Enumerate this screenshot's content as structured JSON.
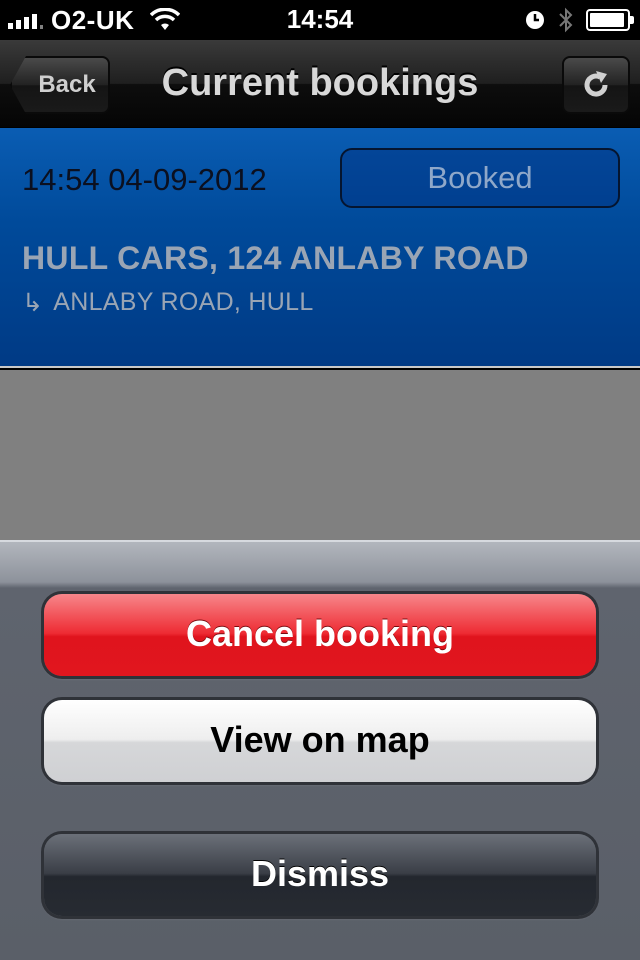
{
  "status_bar": {
    "carrier": "O2-UK",
    "time": "14:54",
    "signal_bars": 4,
    "battery_level": 0.95
  },
  "nav": {
    "title": "Current bookings",
    "back_label": "Back"
  },
  "booking": {
    "datetime": "14:54 04-09-2012",
    "status": "Booked",
    "pickup": "HULL CARS, 124 ANLABY ROAD",
    "destination_arrow": "↳",
    "destination": "ANLABY ROAD, HULL"
  },
  "action_sheet": {
    "cancel_label": "Cancel booking",
    "map_label": "View on map",
    "dismiss_label": "Dismiss"
  },
  "colors": {
    "card_blue": "#004a9a",
    "cancel_red": "#e0141d",
    "sheet_gray": "#5a5f68"
  }
}
